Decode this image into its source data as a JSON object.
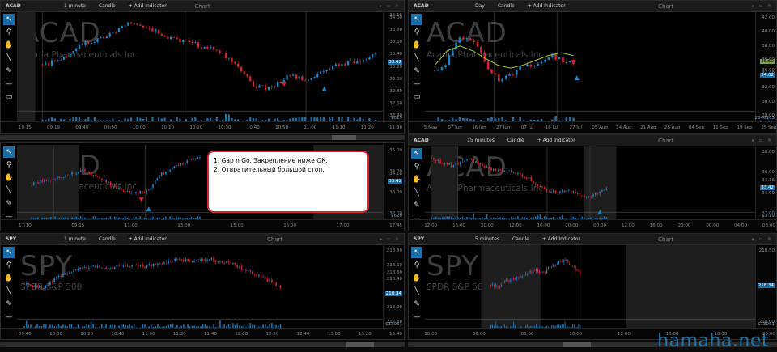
{
  "panels": {
    "p1": {
      "symbol": "ACAD",
      "interval": "1 minute",
      "style": "Candle",
      "add": "+ Add Indicator",
      "title": "Chart",
      "ticker": "ACAD",
      "company": "Acadia Pharmaceuticals Inc",
      "price_labels": [
        "34.00",
        "33.80",
        "33.60",
        "33.40",
        "33.20",
        "33.00",
        "32.80",
        "32.60",
        "32.40"
      ],
      "price_top": "34.16",
      "price_hl": "33.42",
      "vol_label": "$019",
      "time_labels": [
        "19:15",
        "09:19",
        "09:40",
        "09:50",
        "10:00",
        "10:10",
        "10:20",
        "10:30",
        "10:40",
        "10:50",
        "11:00",
        "11:10",
        "11:20",
        "11:30"
      ]
    },
    "p2": {
      "symbol": "ACAD",
      "interval": "Day",
      "style": "Candle",
      "add": "+ Add Indicator",
      "title": "Chart",
      "ticker": "ACAD",
      "company": "Acadia Pharmaceuticals Inc",
      "price_labels": [
        "42.00",
        "40.00",
        "38.00",
        "36.00",
        "34.00",
        "32.00",
        "30.00",
        "28.00"
      ],
      "price_hl": "34.02",
      "price_green": "35.60",
      "price_other": "36.00",
      "vol_label": "2846105",
      "time_labels": [
        "5 May",
        "07 Jun",
        "16 Jun",
        "27 Jun",
        "07 Jul",
        "18 Jul",
        "27 Jul",
        "05 Aug",
        "14 Aug",
        "21 Aug",
        "28 Aug",
        "04 Sep",
        "11 Sep",
        "19 Sep",
        "25 Sep"
      ]
    },
    "p3": {
      "symbol": "",
      "interval": "",
      "style": "",
      "add": "",
      "title": "",
      "ticker": "ACAD",
      "company": "Acadia Pharmaceuticals Inc",
      "price_labels": [
        "35.00",
        "34.00",
        "33.00",
        "32.00"
      ],
      "price_hl": "33.42",
      "price_other": "34.16",
      "vol_label": "$620",
      "time_labels": [
        "17:10",
        "09:15",
        "11:00",
        "13:00",
        "15:00",
        "16:00",
        "17:00",
        "17:45"
      ]
    },
    "p4": {
      "symbol": "ACAD",
      "interval": "15 minutes",
      "style": "Candle",
      "add": "+ Add Indicator",
      "title": "Chart",
      "ticker": "ACAD",
      "company": "Acadia Pharmaceuticals Inc",
      "price_labels": [
        "38.00",
        "36.00",
        "34.00",
        "32.00"
      ],
      "price_hl": "33.42",
      "price_other": "34.16",
      "vol_label": "$3.19",
      "time_labels": [
        "12:00",
        "16:00",
        "20:00",
        "12:00",
        "16:00",
        "20:00",
        "00:00",
        "12:00",
        "16:00",
        "20:00",
        "00:00",
        "04:00",
        "08:00"
      ]
    },
    "p5": {
      "symbol": "SPY",
      "interval": "1 minute",
      "style": "Candle",
      "add": "+ Add Indicator",
      "title": "Chart",
      "ticker": "SPY",
      "company": "SPDR S&P 500",
      "price_labels": [
        "218.80",
        "218.60",
        "218.40",
        "218.20",
        "218.00",
        "217.80"
      ],
      "price_hl": "218.34",
      "price_other": "218.60",
      "vol_label": "$13061",
      "time_labels": [
        "09:40",
        "10:00",
        "10:20",
        "10:40",
        "11:00",
        "11:20",
        "11:40",
        "12:00",
        "12:20",
        "12:40",
        "13:00",
        "13:20",
        "13:40"
      ]
    },
    "p6": {
      "symbol": "SPY",
      "interval": "5 minutes",
      "style": "Candle",
      "add": "+ Add Indicator",
      "title": "Chart",
      "ticker": "SPY",
      "company": "SPDR S&P 500",
      "price_labels": [
        "218.50",
        "218.00"
      ],
      "price_hl": "218.34",
      "vol_label": "$13061",
      "time_labels": [
        "18:00",
        "06:00",
        "08:00",
        "10:00",
        "12:00",
        "16:00",
        "18:00",
        "20:00"
      ]
    }
  },
  "note": {
    "line1": "1. Gap n Go. Закрепление ниже ОК.",
    "line2": "2. Отвратительный большой стоп."
  },
  "watermark": "hamaha.net",
  "icons": [
    "pointer-icon",
    "zoom-icon",
    "hand-icon",
    "line-icon",
    "pencil-icon",
    "hline-icon",
    "rect-icon"
  ],
  "colors": {
    "up": "#1c86c8",
    "down": "#d8222e",
    "ma": "#a8d11f",
    "active_tool": "#1a6ea8"
  }
}
